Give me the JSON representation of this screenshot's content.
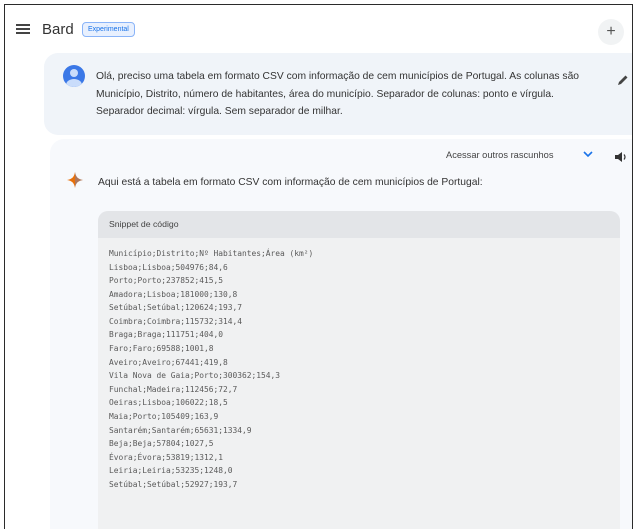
{
  "header": {
    "brand": "Bard",
    "badge": "Experimental",
    "menu_icon": "hamburger-menu-icon",
    "new_chat_icon": "plus-icon"
  },
  "prompt": {
    "avatar_icon": "user-avatar-icon",
    "text": "Olá, preciso uma tabela em formato CSV com informação de cem municípios de Portugal. As colunas são Município, Distrito, número de habitantes, área do município. Separador de colunas: ponto e vírgula. Separador decimal: vírgula. Sem separador de milhar.",
    "edit_icon": "pencil-icon"
  },
  "response": {
    "drafts_label": "Acessar outros rascunhos",
    "drafts_icon": "chevron-down-icon",
    "speaker_icon": "speaker-icon",
    "sparkle_icon": "bard-sparkle-icon",
    "text": "Aqui está a tabela em formato CSV com informação de cem municípios de Portugal:",
    "code": {
      "title": "Snippet de código",
      "lines": [
        "Município;Distrito;Nº Habitantes;Área (km²)",
        "Lisboa;Lisboa;504976;84,6",
        "Porto;Porto;237852;415,5",
        "Amadora;Lisboa;181000;130,8",
        "Setúbal;Setúbal;120624;193,7",
        "Coimbra;Coimbra;115732;314,4",
        "Braga;Braga;111751;404,0",
        "Faro;Faro;69588;1001,8",
        "Aveiro;Aveiro;67441;419,8",
        "Vila Nova de Gaia;Porto;300362;154,3",
        "Funchal;Madeira;112456;72,7",
        "Oeiras;Lisboa;106022;18,5",
        "Maia;Porto;105409;163,9",
        "Santarém;Santarém;65631;1334,9",
        "Beja;Beja;57804;1027,5",
        "Évora;Évora;53819;1312,1",
        "Leiria;Leiria;53235;1248,0",
        "Setúbal;Setúbal;52927;193,7"
      ]
    }
  }
}
